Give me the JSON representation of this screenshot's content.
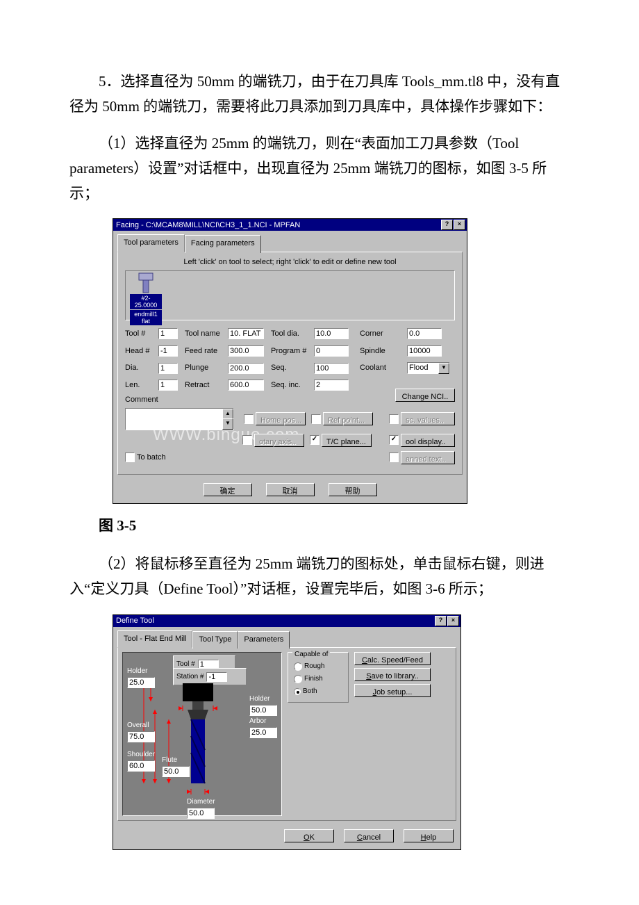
{
  "doc": {
    "p1": "5．选择直径为 50mm 的端铣刀，由于在刀具库 Tools_mm.tl8 中，没有直径为 50mm 的端铣刀，需要将此刀具添加到刀具库中，具体操作步骤如下：",
    "p2": "（1）选择直径为 25mm 的端铣刀，则在“表面加工刀具参数（Tool parameters）设置”对话框中，出现直径为 25mm 端铣刀的图标，如图 3-5 所示；",
    "caption1": "图 3-5",
    "p3": "（2）将鼠标移至直径为 25mm 端铣刀的图标处，单击鼠标右键，则进入“定义刀具（Define Tool）”对话框，设置完毕后，如图 3-6 所示；"
  },
  "dlg1": {
    "title": "Facing - C:\\MCAM8\\MILL\\NCI\\CH3_1_1.NCI - MPFAN",
    "help_btn": "?",
    "close_btn": "×",
    "tabs": {
      "tool_params": "Tool parameters",
      "facing_params": "Facing parameters"
    },
    "hint": "Left 'click' on tool to select; right 'click' to edit or define new tool",
    "tool_icon": {
      "line1": "#2- 25.0000",
      "line2": "endmill1 flat"
    },
    "labels": {
      "tool_no": "Tool #",
      "tool_name": "Tool name",
      "tool_dia": "Tool dia.",
      "corner": "Corner",
      "head_no": "Head #",
      "feed_rate": "Feed rate",
      "program_no": "Program #",
      "spindle": "Spindle",
      "dia": "Dia.",
      "plunge": "Plunge",
      "seq": "Seq.",
      "coolant": "Coolant",
      "len": "Len.",
      "retract": "Retract",
      "seq_inc": "Seq. inc.",
      "comment": "Comment",
      "to_batch": "To batch"
    },
    "values": {
      "tool_no": "1",
      "tool_name": "10. FLAT",
      "tool_dia": "10.0",
      "corner": "0.0",
      "head_no": "-1",
      "feed_rate": "300.0",
      "program_no": "0",
      "spindle": "10000",
      "dia": "1",
      "plunge": "200.0",
      "seq": "100",
      "coolant": "Flood",
      "len": "1",
      "retract": "600.0",
      "seq_inc": "2"
    },
    "buttons": {
      "change_nci": "Change NCI..",
      "home_pos": "Home pos...",
      "ref_point": "Ref point...",
      "sc_values": "sc. values..",
      "rotary_axis": "otary axis..",
      "tc_plane": "T/C plane...",
      "ool_display": "ool display..",
      "anned_text": "anned text..",
      "ok": "确定",
      "cancel": "取消",
      "help": "帮助"
    },
    "checks": {
      "home_pos": false,
      "ref_point": false,
      "sc_values": false,
      "rotary_axis": false,
      "tc_plane": true,
      "ool_display": true,
      "anned_text": false,
      "to_batch": false
    },
    "watermark": "WWW.binguo.com"
  },
  "dlg2": {
    "title": "Define Tool",
    "help_btn": "?",
    "close_btn": "×",
    "tabs": {
      "tool": "Tool - Flat End Mill",
      "tool_type": "Tool Type",
      "parameters": "Parameters"
    },
    "labels": {
      "tool_no": "Tool #",
      "station_no": "Station #",
      "holder": "Holder",
      "holder_dia": "Holder",
      "arbor": "Arbor",
      "overall": "Overall",
      "shoulder": "Shoulder",
      "flute": "Flute",
      "diameter": "Diameter"
    },
    "values": {
      "tool_no": "1",
      "station_no": "-1",
      "holder": "25.0",
      "holder_dia": "50.0",
      "arbor": "25.0",
      "overall": "75.0",
      "shoulder": "60.0",
      "flute": "50.0",
      "diameter": "50.0"
    },
    "capable": {
      "title": "Capable of",
      "rough": "Rough",
      "finish": "Finish",
      "both": "Both",
      "selected": "Both"
    },
    "buttons": {
      "calc": "Calc. Speed/Feed",
      "save": "ave to library..",
      "job": "Job setup...",
      "ok": "OK",
      "cancel": "Cancel",
      "help": "Help"
    }
  }
}
